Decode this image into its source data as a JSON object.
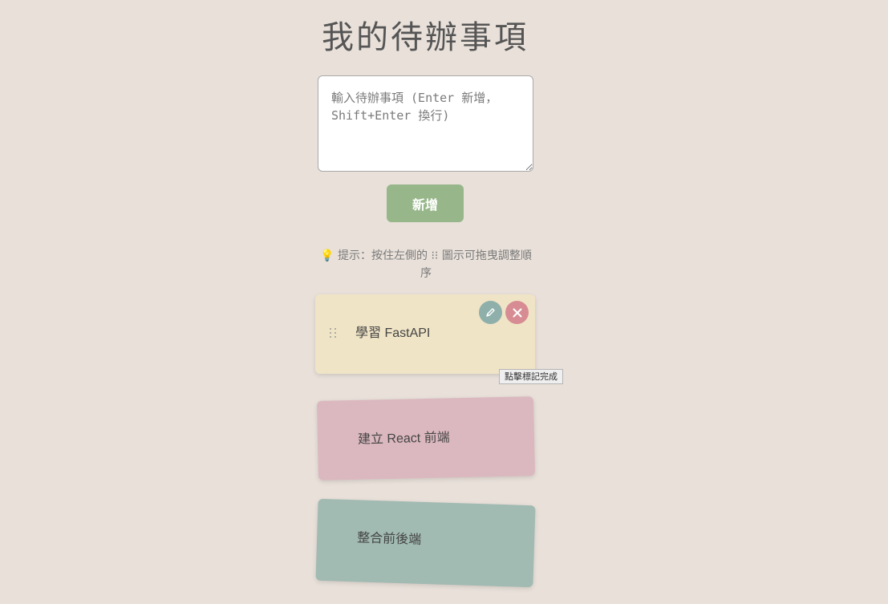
{
  "page": {
    "title": "我的待辦事項"
  },
  "input": {
    "placeholder": "輸入待辦事項 (Enter 新增，Shift+Enter 換行)",
    "value": ""
  },
  "add_button": {
    "label": "新增"
  },
  "hint": {
    "icon": "lightbulb-icon",
    "text": "提示：按住左側的 ⁝⁝ 圖示可拖曳調整順序"
  },
  "todos": [
    {
      "text": "學習 FastAPI",
      "color": "#f0e4c6"
    },
    {
      "text": "建立 React 前端",
      "color": "#dbb8bf"
    },
    {
      "text": "整合前後端",
      "color": "#a1bab2"
    }
  ],
  "tooltip": {
    "text": "點擊標記完成"
  },
  "colors": {
    "background": "#e8e0d9",
    "button": "#97b68a",
    "edit": "#8fb0aa",
    "delete": "#d78c93"
  }
}
